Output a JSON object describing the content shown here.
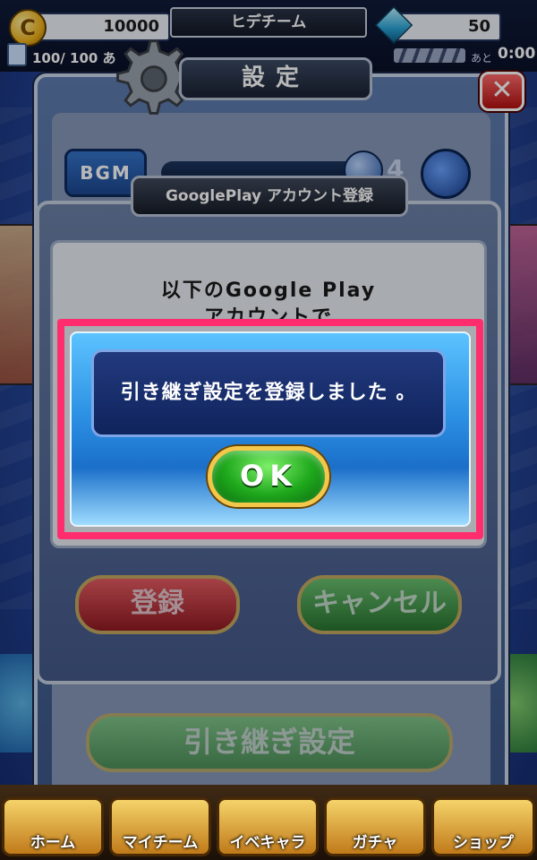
{
  "top_bar": {
    "coin_symbol": "C",
    "coins": "10000",
    "team_name": "ヒデチーム",
    "gems": "50",
    "stamina": "100/ 100 あ",
    "timer_label": "あと",
    "timer_value": "0:00"
  },
  "settings": {
    "title": "設定",
    "close_label": "✕",
    "bgm_label": "BGM",
    "bgm_value": "4",
    "transfer_button": "引き継ぎ設定"
  },
  "google_play_dialog": {
    "title": "GooglePlay アカウント登録",
    "message": "以下のGoogle Play\nアカウントで",
    "register_button": "登録",
    "cancel_button": "キャンセル"
  },
  "alert": {
    "message": "引き継ぎ設定を登録しました 。",
    "ok_button": "OK"
  },
  "bottom_nav": {
    "items": [
      {
        "label": "ホーム"
      },
      {
        "label": "マイチーム"
      },
      {
        "label": "イベキャラ"
      },
      {
        "label": "ガチャ"
      },
      {
        "label": "ショップ"
      }
    ]
  },
  "colors": {
    "highlight": "#ff2d6e",
    "ok_green": "#1fa81c",
    "alert_blue": "#2a8ee2"
  }
}
